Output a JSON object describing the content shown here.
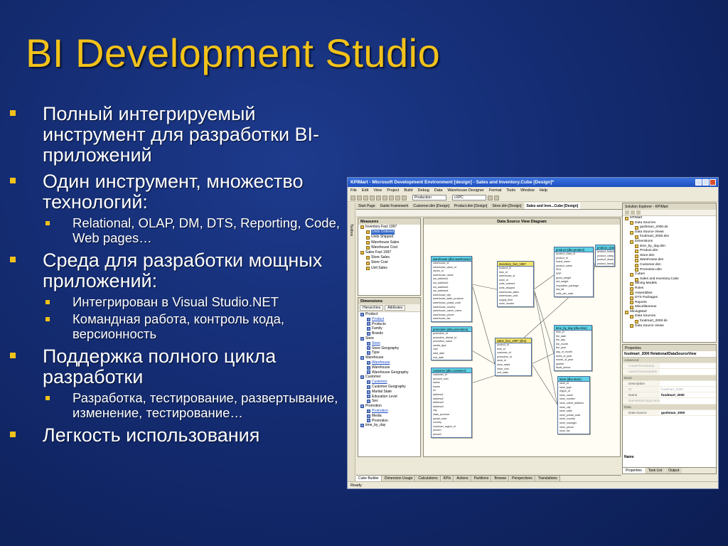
{
  "slide": {
    "title": "BI Development Studio",
    "bullets": [
      {
        "text": "Полный интегрируемый инструмент для разработки BI-приложений",
        "subs": []
      },
      {
        "text": "Один инструмент, множество технологий:",
        "subs": [
          "Relational, OLAP, DM, DTS, Reporting, Code, Web pages…"
        ]
      },
      {
        "text": "Среда для разработки мощных приложений:",
        "subs": [
          "Интегрирован в Visual Studio.NET",
          "Командная работа, контроль кода, версионность"
        ]
      },
      {
        "text": "Поддержка полного цикла разработки",
        "subs": [
          "Разработка, тестирование, развертывание, изменение, тестирование…"
        ]
      },
      {
        "text": "Легкость использования",
        "subs": []
      }
    ]
  },
  "ide": {
    "title": "KPIMart - Microsoft Development Environment [design] - Sales and Inventory.Cube [Design]*",
    "menu": [
      "File",
      "Edit",
      "View",
      "Project",
      "Build",
      "Debug",
      "Data",
      "Warehouse Designer",
      "Format",
      "Tools",
      "Window",
      "Help"
    ],
    "config_combo": "Production",
    "platform_combo": "cXPC",
    "toolbox_label": "Toolbox",
    "doc_tabs": [
      "Start Page",
      "Guide Framework",
      "Customer.dim [Design]",
      "Product.dim [Design]",
      "Store.dim [Design]",
      "Sales and Inve...Cube [Design]"
    ],
    "measures": {
      "header": "Measures",
      "items": [
        {
          "label": "Inventory Fact 1997",
          "level": 0,
          "icon": "cube-icon",
          "selected": false
        },
        {
          "label": "Units Ordered",
          "level": 1,
          "icon": "measure-icon",
          "selected": true
        },
        {
          "label": "Units Shipped",
          "level": 1,
          "icon": "measure-icon",
          "selected": false
        },
        {
          "label": "Warehouse Sales",
          "level": 1,
          "icon": "measure-icon",
          "selected": false
        },
        {
          "label": "Warehouse Cost",
          "level": 1,
          "icon": "measure-icon",
          "selected": false
        },
        {
          "label": "Sales Fact 1997",
          "level": 0,
          "icon": "cube-icon",
          "selected": false
        },
        {
          "label": "Store Sales",
          "level": 1,
          "icon": "measure-icon",
          "selected": false
        },
        {
          "label": "Store Cost",
          "level": 1,
          "icon": "measure-icon",
          "selected": false
        },
        {
          "label": "Unit Sales",
          "level": 1,
          "icon": "measure-icon",
          "selected": false
        }
      ]
    },
    "dimensions": {
      "header": "Dimensions",
      "tabs": [
        "Hierarchies",
        "Attributes"
      ],
      "items": [
        {
          "label": "Product",
          "level": 0,
          "link": false
        },
        {
          "label": "Product",
          "level": 1,
          "link": true
        },
        {
          "label": "Products",
          "level": 1,
          "link": false
        },
        {
          "label": "Family",
          "level": 1,
          "link": false
        },
        {
          "label": "Brands",
          "level": 1,
          "link": false
        },
        {
          "label": "Store",
          "level": 0,
          "link": false
        },
        {
          "label": "Store",
          "level": 1,
          "link": true
        },
        {
          "label": "Store Geography",
          "level": 1,
          "link": false
        },
        {
          "label": "Type",
          "level": 1,
          "link": false
        },
        {
          "label": "Warehouse",
          "level": 0,
          "link": false
        },
        {
          "label": "Warehouse",
          "level": 1,
          "link": true
        },
        {
          "label": "Warehouse",
          "level": 1,
          "link": false
        },
        {
          "label": "Warehouse Geography",
          "level": 1,
          "link": false
        },
        {
          "label": "Customer",
          "level": 0,
          "link": false
        },
        {
          "label": "Customer",
          "level": 1,
          "link": true
        },
        {
          "label": "Customer Geography",
          "level": 1,
          "link": false
        },
        {
          "label": "Marital State",
          "level": 1,
          "link": false
        },
        {
          "label": "Education Level",
          "level": 1,
          "link": false
        },
        {
          "label": "Sex",
          "level": 1,
          "link": false
        },
        {
          "label": "Promotion",
          "level": 0,
          "link": false
        },
        {
          "label": "Promotion",
          "level": 1,
          "link": true
        },
        {
          "label": "Media",
          "level": 1,
          "link": false
        },
        {
          "label": "Promotion",
          "level": 1,
          "link": false
        },
        {
          "label": "time_by_day",
          "level": 0,
          "link": false
        }
      ]
    },
    "dsv": {
      "header": "Data Source View Diagram",
      "tables": [
        {
          "name": "warehouse (dbo.warehouse)",
          "color": "cyan",
          "rows": [
            "warehouse_id",
            "warehouse_class_id",
            "stores_id",
            "warehouse_name",
            "wa_address1",
            "wa_address2",
            "wa_address3",
            "wa_address4",
            "warehouse_city",
            "warehouse_state_province",
            "warehouse_postal_code",
            "warehouse_country",
            "warehouse_owner_name",
            "warehouse_phone",
            "warehouse_fax"
          ]
        },
        {
          "name": "inventory_fact_1997",
          "color": "yellow",
          "rows": [
            "product_id",
            "time_id",
            "warehouse_id",
            "store_id",
            "units_ordered",
            "units_shipped",
            "warehouse_sales",
            "warehouse_cost",
            "supply_time",
            "store_invoice"
          ]
        },
        {
          "name": "product (dbo.product)",
          "color": "cyan",
          "rows": [
            "product_class_id",
            "product_id",
            "brand_name",
            "product_name",
            "SKU",
            "SRP",
            "gross_weight",
            "net_weight",
            "recyclable_package",
            "low_fat",
            "units_per_case"
          ]
        },
        {
          "name": "product_class",
          "color": "cyan",
          "rows": [
            "product_subcat",
            "product_categ",
            "product_depar",
            "product_family"
          ]
        },
        {
          "name": "promotion (dbo.promotion)",
          "color": "cyan",
          "rows": [
            "promotion_id",
            "promotion_district_id",
            "promotion_name",
            "media_type",
            "cost",
            "start_date",
            "end_date"
          ]
        },
        {
          "name": "sales_fact_1997 (dbo)",
          "color": "yellow",
          "rows": [
            "product_id",
            "time_id",
            "customer_id",
            "promotion_id",
            "store_id",
            "store_sales",
            "store_cost",
            "unit_sales"
          ]
        },
        {
          "name": "time_by_day (dbo.time)",
          "color": "cyan",
          "rows": [
            "time_id",
            "the_date",
            "the_day",
            "the_month",
            "the_year",
            "day_of_month",
            "week_of_year",
            "month_of_year",
            "quarter",
            "fiscal_period"
          ]
        },
        {
          "name": "customer (dbo.customer)",
          "color": "cyan",
          "rows": [
            "customer_id",
            "account_num",
            "lname",
            "fname",
            "mi",
            "address1",
            "address2",
            "address3",
            "address4",
            "city",
            "state_province",
            "postal_code",
            "country",
            "customer_region_id",
            "phone1",
            "phone2"
          ]
        },
        {
          "name": "store (dbo.store)",
          "color": "cyan",
          "rows": [
            "store_id",
            "store_type",
            "region_id",
            "store_name",
            "store_number",
            "store_street_address",
            "store_city",
            "store_state",
            "store_postal_code",
            "store_country",
            "store_manager",
            "store_phone",
            "store_fax"
          ]
        }
      ]
    },
    "bottom_tabs": [
      "Cube Builder",
      "Dimension Usage",
      "Calculations",
      "KPIs",
      "Actions",
      "Partitions",
      "Browse",
      "Perspectives",
      "Translations"
    ],
    "solution": {
      "header": "Solution Explorer - KPIMart",
      "items": [
        {
          "label": "KPIMart",
          "level": 0,
          "icon": "project-icon"
        },
        {
          "label": "Data Sources",
          "level": 1,
          "icon": "folder-icon"
        },
        {
          "label": "gushman_2000.ds",
          "level": 2,
          "icon": "file-icon"
        },
        {
          "label": "Data Source Views",
          "level": 1,
          "icon": "folder-icon"
        },
        {
          "label": "foodmart_2000.dsv",
          "level": 2,
          "icon": "file-icon"
        },
        {
          "label": "Dimensions",
          "level": 1,
          "icon": "folder-icon"
        },
        {
          "label": "time_by_day.dim",
          "level": 2,
          "icon": "file-icon"
        },
        {
          "label": "Product.dim",
          "level": 2,
          "icon": "file-icon"
        },
        {
          "label": "Store.dim",
          "level": 2,
          "icon": "file-icon"
        },
        {
          "label": "Warehouse.dim",
          "level": 2,
          "icon": "file-icon"
        },
        {
          "label": "Customer.dim",
          "level": 2,
          "icon": "file-icon"
        },
        {
          "label": "Promotion.dim",
          "level": 2,
          "icon": "file-icon"
        },
        {
          "label": "Cubes",
          "level": 1,
          "icon": "folder-icon"
        },
        {
          "label": "Sales and Inventory.Cube",
          "level": 2,
          "icon": "file-icon"
        },
        {
          "label": "Mining Models",
          "level": 1,
          "icon": "folder-icon"
        },
        {
          "label": "Roles",
          "level": 1,
          "icon": "folder-icon"
        },
        {
          "label": "Assemblies",
          "level": 1,
          "icon": "folder-icon"
        },
        {
          "label": "DTS Packages",
          "level": 1,
          "icon": "folder-icon"
        },
        {
          "label": "Reports",
          "level": 1,
          "icon": "folder-icon"
        },
        {
          "label": "Miscellaneous",
          "level": 1,
          "icon": "folder-icon"
        },
        {
          "label": "MiningMart",
          "level": 0,
          "icon": "project-icon"
        },
        {
          "label": "Data Sources",
          "level": 1,
          "icon": "folder-icon"
        },
        {
          "label": "foodmart_2000.ds",
          "level": 2,
          "icon": "file-icon"
        },
        {
          "label": "Data Source Views",
          "level": 1,
          "icon": "folder-icon"
        }
      ]
    },
    "properties": {
      "header": "Properties",
      "object": "foodmart_2000   Relational/DataSourceView",
      "rows": [
        {
          "key": "Advanced",
          "value": "",
          "type": "cat"
        },
        {
          "key": "CreateTimestamp",
          "value": "",
          "type": "dim"
        },
        {
          "key": "LastSchemaUpdate",
          "value": "",
          "type": "dim"
        },
        {
          "key": "Basic",
          "value": "",
          "type": "cat"
        },
        {
          "key": "Description",
          "value": "",
          "type": "normal"
        },
        {
          "key": "ID",
          "value": "foodmart_2000",
          "type": "dim"
        },
        {
          "key": "Name",
          "value": "foodmart_2000",
          "type": "bold"
        },
        {
          "key": "NameMatchingCriteria",
          "value": "",
          "type": "dim"
        },
        {
          "key": "Data",
          "value": "",
          "type": "cat"
        },
        {
          "key": "Data Source",
          "value": "gushman_2000",
          "type": "bold"
        }
      ],
      "name_label": "Name",
      "tabs": [
        "Properties",
        "Task List",
        "Output"
      ]
    },
    "status": "Ready"
  }
}
